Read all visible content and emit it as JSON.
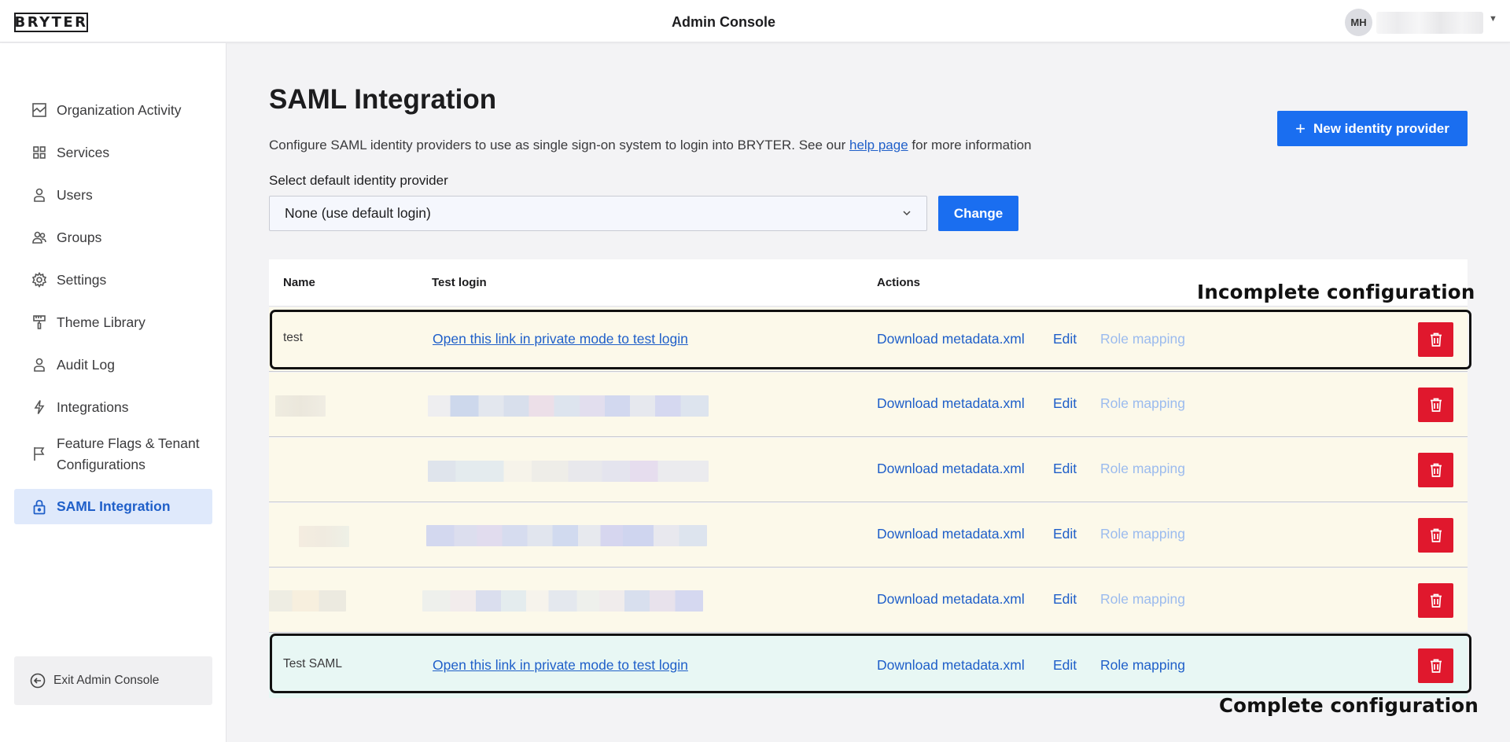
{
  "header": {
    "logo": "BRYTER",
    "title": "Admin Console",
    "user_initials": "MH"
  },
  "sidebar": {
    "items": [
      {
        "label": "Organization Activity",
        "icon": "activity-icon"
      },
      {
        "label": "Services",
        "icon": "grid-icon"
      },
      {
        "label": "Users",
        "icon": "user-icon"
      },
      {
        "label": "Groups",
        "icon": "group-icon"
      },
      {
        "label": "Settings",
        "icon": "gear-icon"
      },
      {
        "label": "Theme Library",
        "icon": "paint-roller-icon"
      },
      {
        "label": "Audit Log",
        "icon": "user-icon"
      },
      {
        "label": "Integrations",
        "icon": "bolt-icon"
      },
      {
        "label": "Feature Flags & Tenant Configurations",
        "label_line1": "Feature Flags & Tenant",
        "label_line2": "Configurations",
        "icon": "flag-icon"
      },
      {
        "label": "SAML Integration",
        "icon": "lock-icon",
        "active": true
      }
    ],
    "exit_label": "Exit Admin Console"
  },
  "main": {
    "title": "SAML Integration",
    "description_prefix": "Configure SAML identity providers to use as single sign-on system to login into BRYTER. See our ",
    "help_link": "help page",
    "description_suffix": " for more information",
    "new_idp_label": "New identity provider",
    "select_label": "Select default identity provider",
    "select_value": "None (use default login)",
    "change_label": "Change"
  },
  "table": {
    "headers": {
      "name": "Name",
      "test_login": "Test login",
      "actions": "Actions"
    },
    "rows": [
      {
        "name": "test",
        "test_login": "Open this link in private mode to test login",
        "download": "Download metadata.xml",
        "edit": "Edit",
        "role_mapping": "Role mapping",
        "status": "incomplete"
      },
      {
        "name": "",
        "test_login": "",
        "download": "Download metadata.xml",
        "edit": "Edit",
        "role_mapping": "Role mapping",
        "status": "incomplete"
      },
      {
        "name": "",
        "test_login": "",
        "download": "Download metadata.xml",
        "edit": "Edit",
        "role_mapping": "Role mapping",
        "status": "incomplete"
      },
      {
        "name": "",
        "test_login": "",
        "download": "Download metadata.xml",
        "edit": "Edit",
        "role_mapping": "Role mapping",
        "status": "incomplete"
      },
      {
        "name": "",
        "test_login": "",
        "download": "Download metadata.xml",
        "edit": "Edit",
        "role_mapping": "Role mapping",
        "status": "incomplete"
      },
      {
        "name": "Test SAML",
        "test_login": "Open this link in private mode to test login",
        "download": "Download metadata.xml",
        "edit": "Edit",
        "role_mapping": "Role mapping",
        "status": "complete"
      }
    ]
  },
  "annotations": {
    "incomplete": "Incomplete configuration",
    "complete": "Complete configuration"
  },
  "colors": {
    "accent": "#1a6ef0",
    "link": "#1f5fc9",
    "danger": "#e0182d",
    "incomplete_row_bg": "#fcf9ea",
    "complete_row_bg": "#e8f7f4",
    "active_nav_bg": "#dfe9fb"
  }
}
